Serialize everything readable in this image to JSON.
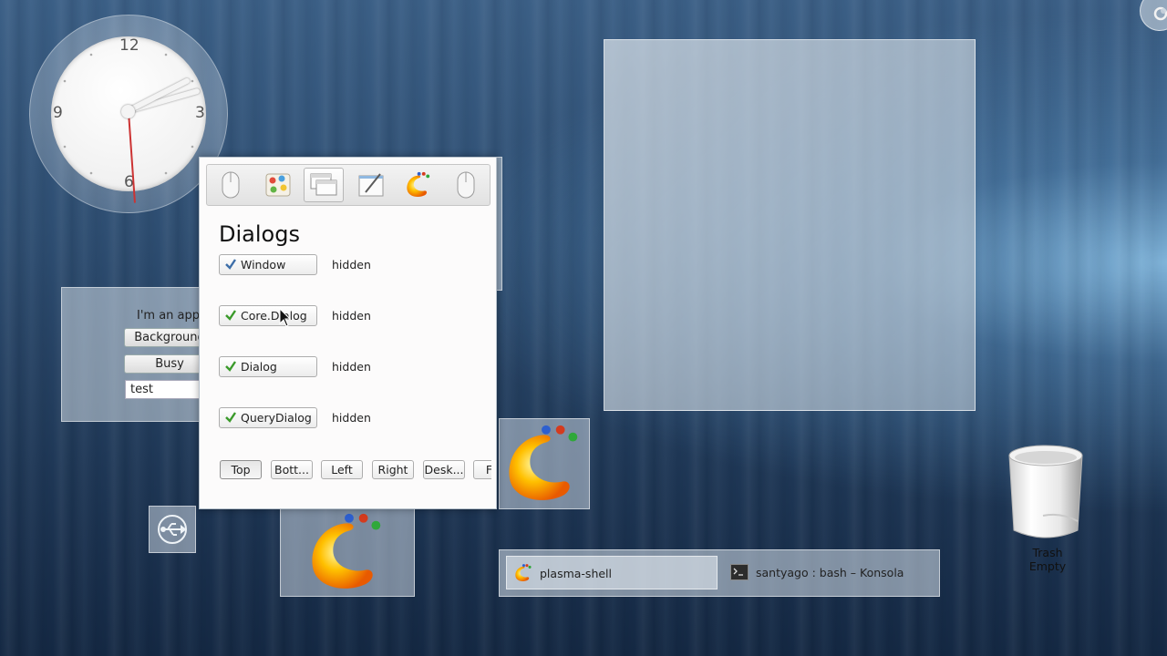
{
  "clock": {
    "numerals": {
      "twelve": "12",
      "three": "3",
      "six": "6",
      "nine": "9"
    }
  },
  "applet": {
    "text": "I'm an applet",
    "background_button": "Background",
    "busy_button": "Busy",
    "input_value": "test"
  },
  "dialog": {
    "tabs": [
      {
        "icon": "mouse-icon"
      },
      {
        "icon": "colors-icon"
      },
      {
        "icon": "windows-icon",
        "active": true
      },
      {
        "icon": "notepad-icon"
      },
      {
        "icon": "plasma-logo-icon"
      },
      {
        "icon": "mouse-icon"
      }
    ],
    "title": "Dialogs",
    "rows": [
      {
        "label": "Window",
        "status": "hidden"
      },
      {
        "label": "Core.Dialog",
        "status": "hidden"
      },
      {
        "label": "Dialog",
        "status": "hidden"
      },
      {
        "label": "QueryDialog",
        "status": "hidden"
      }
    ],
    "positions": [
      "Top",
      "Bott...",
      "Left",
      "Right",
      "Desk...",
      "Flo"
    ]
  },
  "taskbar": {
    "tasks": [
      {
        "icon": "plasma-logo-icon",
        "label": "plasma-shell",
        "active": true
      },
      {
        "icon": "terminal-icon",
        "label": "santyago : bash – Konsola",
        "active": false
      }
    ]
  },
  "trash": {
    "name": "Trash",
    "status": "Empty"
  },
  "colors": {
    "accent_check": "#3a9a2a",
    "dialog_bg": "#fcfbfb"
  }
}
